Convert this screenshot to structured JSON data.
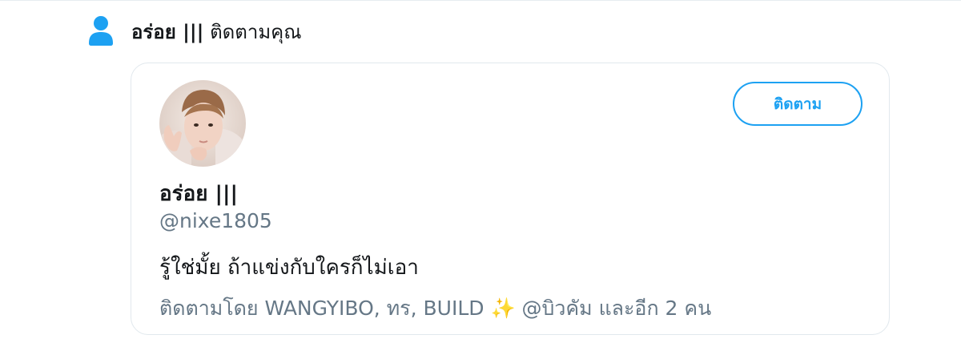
{
  "notification": {
    "icon": "person-icon",
    "name": "อร่อย |||",
    "action": "ติดตามคุณ"
  },
  "user_card": {
    "display_name": "อร่อย |||",
    "handle": "@nixe1805",
    "bio": "รู้ใช่มั้ย ถ้าแข่งกับใครก็ไม่เอา",
    "followed_by": "ติดตามโดย WANGYIBO, ทร, BUILD ✨ @บิวคัม และอีก 2 คน",
    "follow_button_label": "ติดตาม",
    "avatar": "avatar-photo"
  },
  "colors": {
    "accent": "#1da1f2",
    "primary_text": "#14171a",
    "secondary_text": "#657786",
    "border": "#e1e8ed"
  }
}
